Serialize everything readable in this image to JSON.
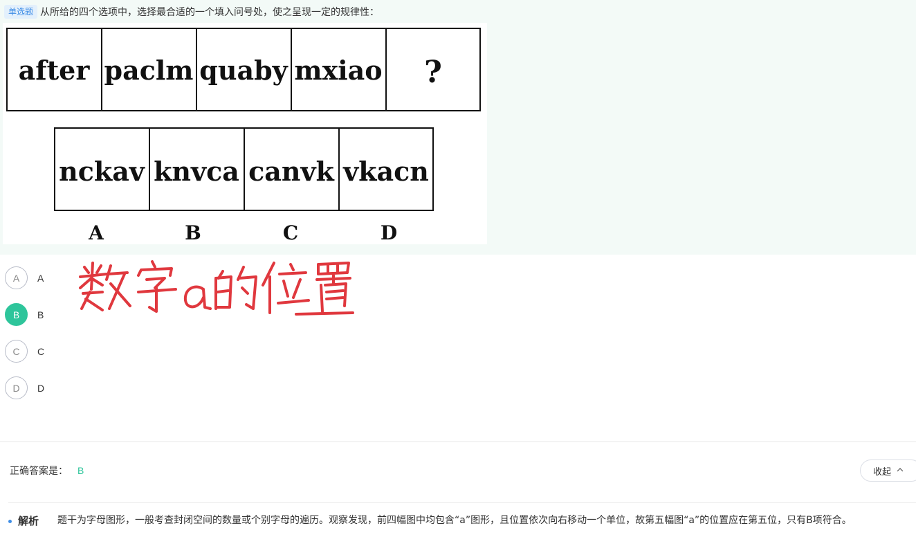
{
  "question": {
    "tag": "单选题",
    "text": "从所给的四个选项中，选择最合适的一个填入问号处，使之呈现一定的规律性："
  },
  "puzzle": {
    "sequence": [
      "after",
      "paclm",
      "quaby",
      "mxiao",
      "?"
    ],
    "choices": [
      "nckav",
      "knvca",
      "canvk",
      "vkacn"
    ],
    "choice_letters": [
      "A",
      "B",
      "C",
      "D"
    ]
  },
  "options": [
    {
      "letter": "A",
      "label": "A",
      "selected": false
    },
    {
      "letter": "B",
      "label": "B",
      "selected": true
    },
    {
      "letter": "C",
      "label": "C",
      "selected": false
    },
    {
      "letter": "D",
      "label": "D",
      "selected": false
    }
  ],
  "annotation": {
    "handwritten_note": "数字a的位置",
    "color": "#e0383e"
  },
  "answer": {
    "label": "正确答案是：",
    "value": "B"
  },
  "collapse_button": {
    "label": "收起",
    "icon": "chevron-up-icon"
  },
  "analysis": {
    "title": "解析",
    "body": "题干为字母图形，一般考查封闭空间的数量或个别字母的遍历。观察发现，前四幅图中均包含“a”图形，且位置依次向右移动一个单位，故第五幅图“a”的位置应在第五位，只有B项符合。"
  },
  "colors": {
    "accent_green": "#2ec59b",
    "tag_blue": "#3f8ee6",
    "panel_bg": "#f3faf7"
  }
}
